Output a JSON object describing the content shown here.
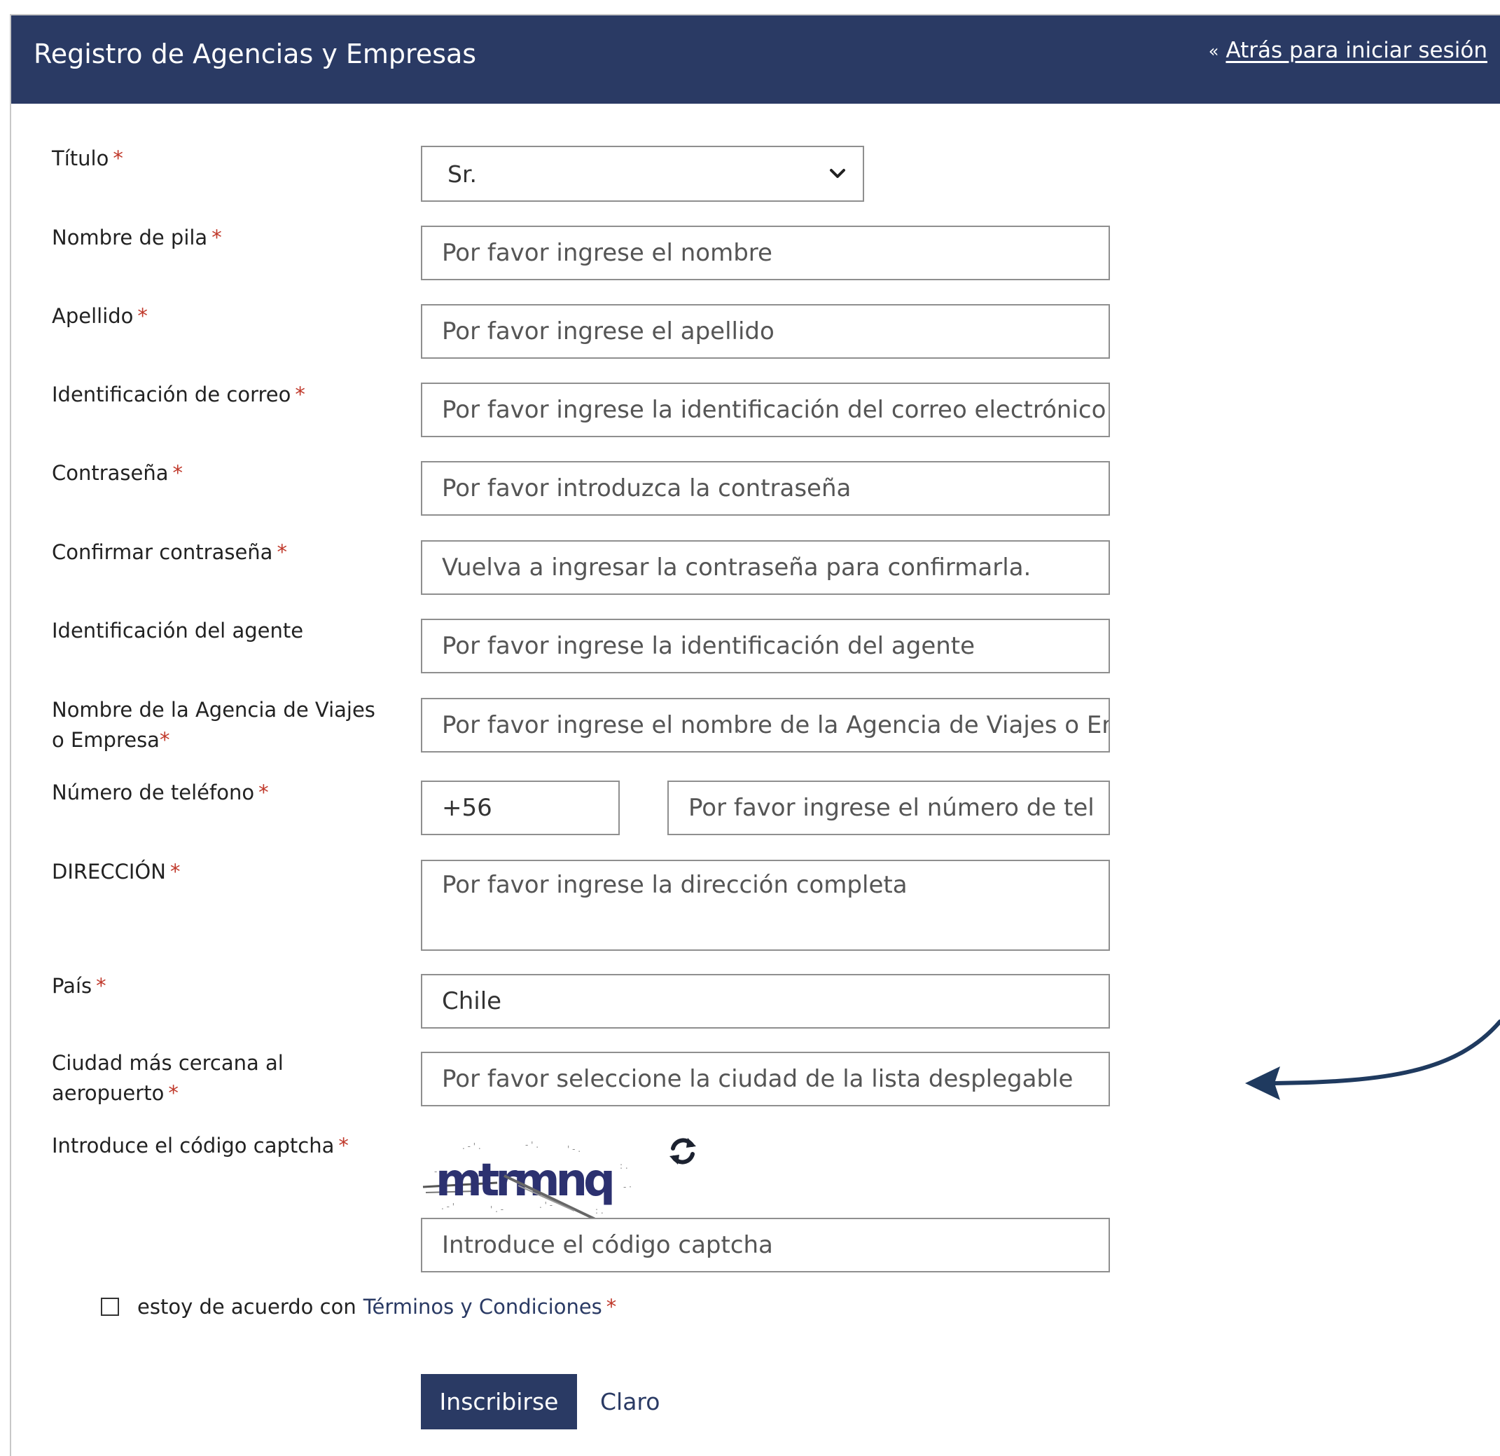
{
  "header": {
    "title": "Registro de Agencias y Empresas",
    "back_arrow": "«",
    "back_link": "Atrás para iniciar sesión",
    "background_color": "#2a3a64"
  },
  "form": {
    "required_mark": "*",
    "title": {
      "label": "Título",
      "selected_value": "Sr."
    },
    "first_name": {
      "label": "Nombre de pila",
      "placeholder": "Por favor ingrese el nombre"
    },
    "last_name": {
      "label": "Apellido",
      "placeholder": "Por favor ingrese el apellido"
    },
    "email": {
      "label": "Identificación de correo",
      "placeholder": "Por favor ingrese la identificación del correo electrónico"
    },
    "password": {
      "label": "Contraseña",
      "placeholder": "Por favor introduzca la contraseña"
    },
    "confirm_password": {
      "label": "Confirmar contraseña",
      "placeholder": "Vuelva a ingresar la contraseña para confirmarla."
    },
    "agent_id": {
      "label": "Identificación del agente",
      "placeholder": "Por favor ingrese la identificación del agente"
    },
    "agency_name": {
      "label_line1": "Nombre de la Agencia de Viajes",
      "label_line2": "o Empresa",
      "placeholder": "Por favor ingrese el nombre de la Agencia de Viajes o Empresa"
    },
    "phone": {
      "label": "Número de teléfono",
      "country_code": "+56",
      "placeholder": "Por favor ingrese el número de teléfono"
    },
    "address": {
      "label": "DIRECCIÓN",
      "placeholder": "Por favor ingrese la dirección completa"
    },
    "country": {
      "label": "País",
      "value": "Chile"
    },
    "nearest_city": {
      "label_line1": "Ciudad más cercana al",
      "label_line2": "aeropuerto",
      "placeholder": "Por favor seleccione la ciudad de la lista desplegable"
    },
    "captcha": {
      "label": "Introduce el código captcha",
      "image_text": "mtrmnq",
      "placeholder": "Introduce el código captcha",
      "refresh_icon": "refresh-icon"
    },
    "terms": {
      "prefix": "estoy de acuerdo con",
      "link": "Términos y Condiciones"
    },
    "submit_label": "Inscribirse",
    "clear_label": "Claro"
  },
  "colors": {
    "accent": "#2a3a64",
    "required": "#c0392b",
    "annotation_arrow": "#1f3a5f"
  }
}
